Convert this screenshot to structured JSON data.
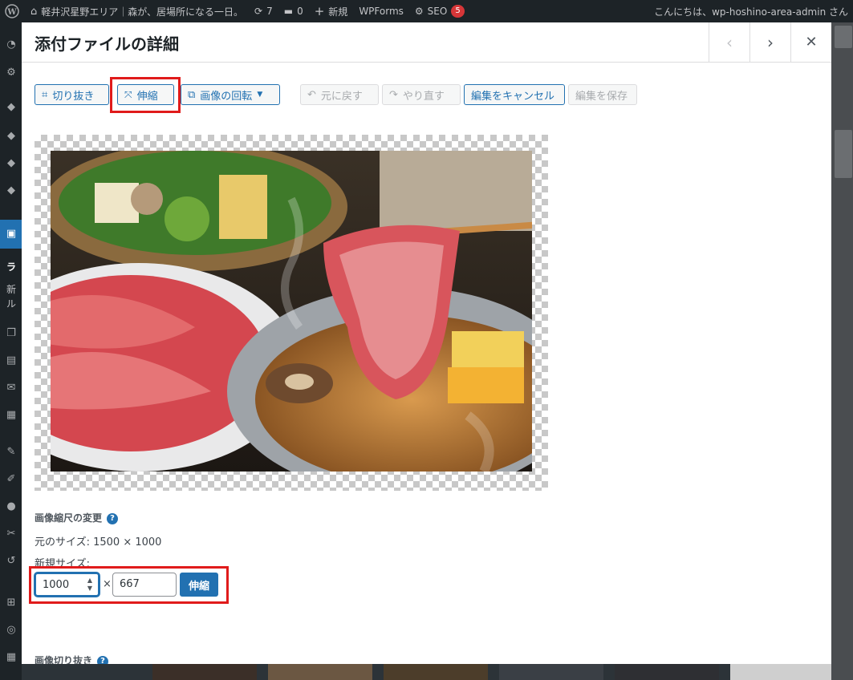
{
  "admin_bar": {
    "site_name": "軽井沢星野エリア｜森が、居場所になる一日。",
    "updates_count": "7",
    "comments_count": "0",
    "new_label": "新規",
    "wpforms_label": "WPForms",
    "seo_label": "SEO",
    "seo_badge": "5",
    "greeting": "こんにちは、wp-hoshino-area-admin さん"
  },
  "sidebar": {
    "text1": "ラ",
    "text2": "新",
    "text3": "ル"
  },
  "modal": {
    "title": "添付ファイルの詳細",
    "prev_icon": "chevron-left-icon",
    "next_icon": "chevron-right-icon",
    "close_icon": "close-icon"
  },
  "toolbar": {
    "crop_label": "切り抜き",
    "scale_label": "伸縮",
    "rotate_label": "画像の回転",
    "undo_label": "元に戻す",
    "redo_label": "やり直す",
    "cancel_label": "編集をキャンセル",
    "save_label": "編集を保存"
  },
  "scale_section": {
    "title": "画像縮尺の変更",
    "original_size": "元のサイズ: 1500 × 1000",
    "new_size_label": "新規サイズ:",
    "width_value": "1000",
    "times": "×",
    "height_value": "667",
    "apply_label": "伸縮"
  },
  "crop_section": {
    "title": "画像切り抜き"
  },
  "colors": {
    "accent": "#2271b1",
    "highlight": "#e01b1b",
    "admin_bar": "#1d2327"
  }
}
